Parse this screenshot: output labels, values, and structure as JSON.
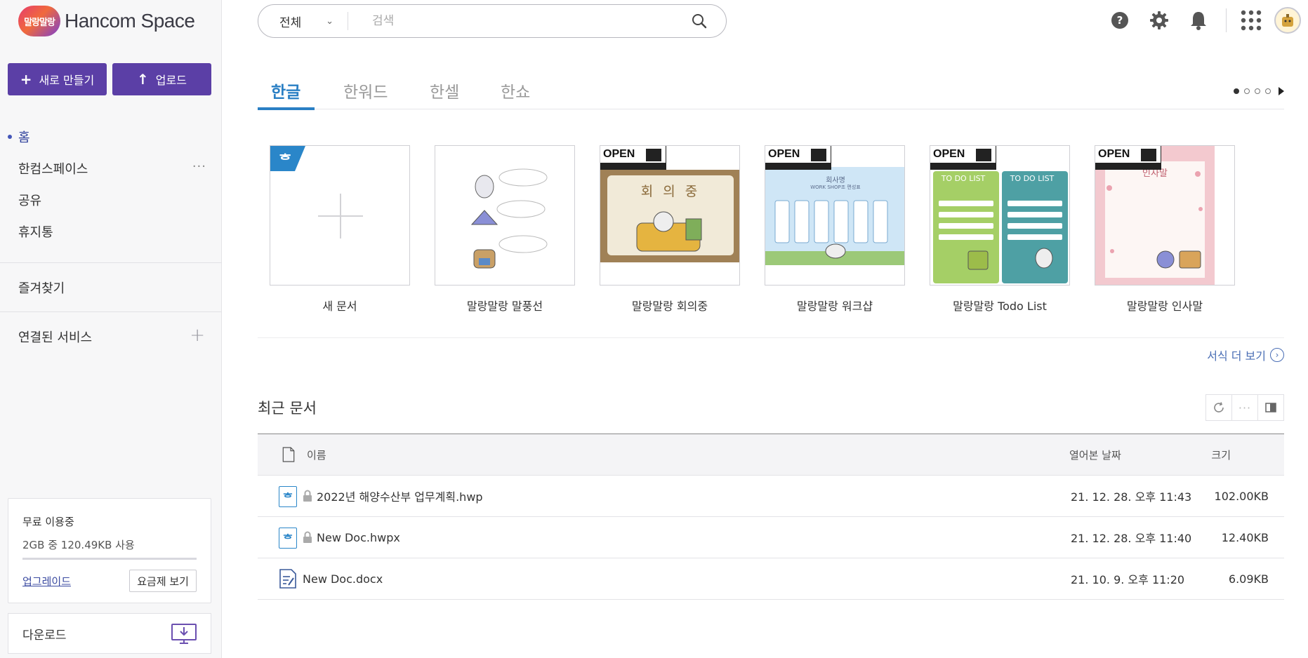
{
  "app": {
    "logo_badge": "말랑말랑",
    "logo_text": "Hancom Space"
  },
  "sidebar": {
    "new_button": "새로 만들기",
    "upload_button": "업로드",
    "items": [
      {
        "label": "홈",
        "active": true
      },
      {
        "label": "한컴스페이스",
        "more": "···"
      },
      {
        "label": "공유"
      },
      {
        "label": "휴지통"
      }
    ],
    "favorites": "즐겨찾기",
    "connected_services": "연결된 서비스",
    "connected_plus": "+",
    "storage": {
      "plan": "무료 이용중",
      "usage": "2GB 중 120.49KB 사용",
      "upgrade": "업그레이드",
      "pricing": "요금제 보기"
    },
    "download": "다운로드"
  },
  "search": {
    "scope": "전체",
    "placeholder": "검색"
  },
  "tabs": [
    {
      "label": "한글",
      "active": true
    },
    {
      "label": "한워드"
    },
    {
      "label": "한셀"
    },
    {
      "label": "한쇼"
    }
  ],
  "templates": [
    {
      "name": "새 문서",
      "kind": "new"
    },
    {
      "name": "말랑말랑 말풍선",
      "kind": "balloon"
    },
    {
      "name": "말랑말랑 회의중",
      "kind": "meeting",
      "thumb_text": "회 의 중"
    },
    {
      "name": "말랑말랑 워크샵",
      "kind": "workshop",
      "thumb_text": "회사명",
      "thumb_sub": "WORK SHOP조 편성표"
    },
    {
      "name": "말랑말랑 Todo List",
      "kind": "todo",
      "thumb_text": "TO DO LIST"
    },
    {
      "name": "말랑말랑 인사말",
      "kind": "greeting",
      "thumb_text": "인사말"
    }
  ],
  "template_badge": "OPEN",
  "more_templates": "서식 더 보기",
  "recent": {
    "title": "최근 문서",
    "columns": {
      "name": "이름",
      "opened": "열어본 날짜",
      "size": "크기"
    },
    "rows": [
      {
        "name": "2022년 해양수산부 업무계획.hwp",
        "date": "21. 12. 28. 오후 11:43",
        "size": "102.00KB",
        "type": "hwp",
        "locked": true
      },
      {
        "name": "New Doc.hwpx",
        "date": "21. 12. 28. 오후 11:40",
        "size": "12.40KB",
        "type": "hwp",
        "locked": true
      },
      {
        "name": "New Doc.docx",
        "date": "21. 10. 9. 오후 11:20",
        "size": "6.09KB",
        "type": "docx",
        "locked": false
      }
    ]
  },
  "colors": {
    "primary": "#5b3fa6",
    "accent_blue": "#2a7fc4",
    "sidebar_bg": "#f7f7f8"
  }
}
